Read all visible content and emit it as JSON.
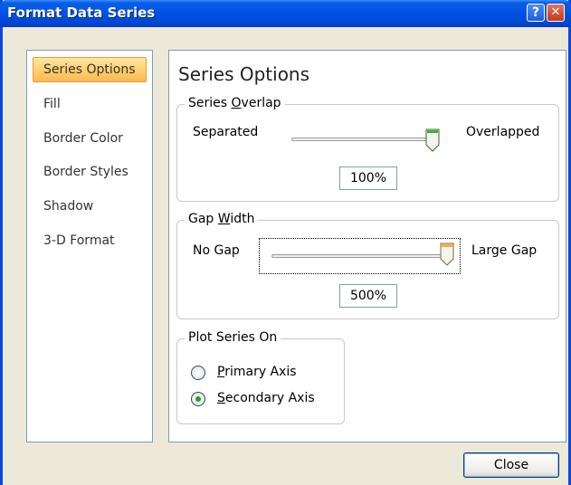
{
  "window": {
    "title": "Format Data Series",
    "help_label": "?",
    "close_label": "✕"
  },
  "nav": {
    "items": [
      {
        "label": "Series Options",
        "active": true
      },
      {
        "label": "Fill"
      },
      {
        "label": "Border Color"
      },
      {
        "label": "Border Styles"
      },
      {
        "label": "Shadow"
      },
      {
        "label": "3-D Format"
      }
    ]
  },
  "main": {
    "heading": "Series Options",
    "overlap": {
      "label_pre": "Series ",
      "label_accel": "O",
      "label_post": "verlap",
      "left_label": "Separated",
      "right_label": "Overlapped",
      "value": "100%",
      "level": 1.0
    },
    "gap": {
      "label_pre": "Gap ",
      "label_accel": "W",
      "label_post": "idth",
      "left_label": "No Gap",
      "right_label": "Large Gap",
      "value": "500%",
      "level": 1.0
    },
    "plot_on": {
      "label": "Plot Series On",
      "primary_accel": "P",
      "primary_rest": "rimary Axis",
      "secondary_accel": "S",
      "secondary_rest": "econdary Axis",
      "selected": "secondary"
    }
  },
  "footer": {
    "close_label": "Close"
  }
}
